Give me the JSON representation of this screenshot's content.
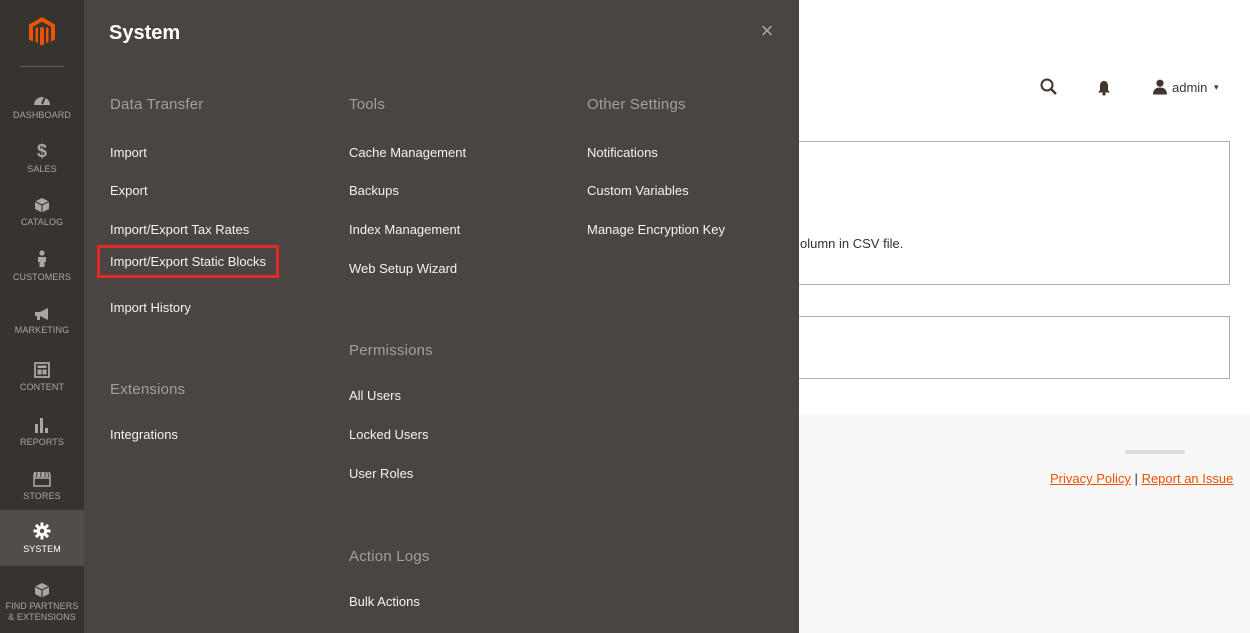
{
  "sidebar": {
    "items": [
      {
        "label": "DASHBOARD",
        "icon": "dashboard-icon"
      },
      {
        "label": "SALES",
        "icon": "dollar-icon"
      },
      {
        "label": "CATALOG",
        "icon": "cube-icon"
      },
      {
        "label": "CUSTOMERS",
        "icon": "person-icon"
      },
      {
        "label": "MARKETING",
        "icon": "megaphone-icon"
      },
      {
        "label": "CONTENT",
        "icon": "layout-icon"
      },
      {
        "label": "REPORTS",
        "icon": "bar-chart-icon"
      },
      {
        "label": "STORES",
        "icon": "storefront-icon"
      },
      {
        "label": "SYSTEM",
        "icon": "gear-icon"
      },
      {
        "label_line1": "FIND PARTNERS",
        "label_line2": "& EXTENSIONS",
        "icon": "box-icon"
      }
    ]
  },
  "flyout": {
    "title": "System",
    "close_icon": "×",
    "data_transfer": {
      "title": "Data Transfer",
      "links": [
        "Import",
        "Export",
        "Import/Export Tax Rates",
        "Import/Export Static Blocks",
        "Import History"
      ]
    },
    "extensions": {
      "title": "Extensions",
      "links": [
        "Integrations"
      ]
    },
    "tools": {
      "title": "Tools",
      "links": [
        "Cache Management",
        "Backups",
        "Index Management",
        "Web Setup Wizard"
      ]
    },
    "permissions": {
      "title": "Permissions",
      "links": [
        "All Users",
        "Locked Users",
        "User Roles"
      ]
    },
    "action_logs": {
      "title": "Action Logs",
      "links": [
        "Bulk Actions"
      ]
    },
    "other_settings": {
      "title": "Other Settings",
      "links": [
        "Notifications",
        "Custom Variables",
        "Manage Encryption Key"
      ]
    }
  },
  "header": {
    "admin_name": "admin",
    "caret": "▾"
  },
  "page": {
    "notice_text": "olumn in CSV file."
  },
  "footer": {
    "privacy_policy": "Privacy Policy",
    "separator": "|",
    "report_issue": "Report an Issue"
  },
  "colors": {
    "sidebar_bg": "#373330",
    "flyout_bg": "#4a4542",
    "active_item_bg": "#524d49",
    "highlight_border": "#e02b27",
    "logo_orange": "#eb5202",
    "link_orange": "#eb5202"
  }
}
